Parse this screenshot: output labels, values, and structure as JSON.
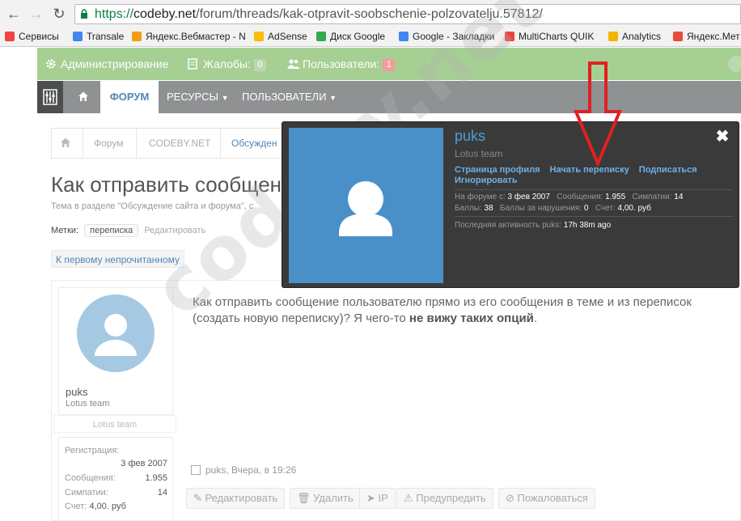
{
  "browser": {
    "url_scheme": "https://",
    "url_host": "codeby.net",
    "url_path": "/forum/threads/kak-otpravit-soobschenie-polzovatelju.57812/",
    "bookmarks": [
      {
        "label": "Сервисы",
        "icon": "apps-grid-icon",
        "color": "#e44"
      },
      {
        "label": "Transale",
        "icon": "google-icon",
        "color": "#4285f4"
      },
      {
        "label": "Яндекс.Вебмастер - N",
        "icon": "yandex-webmaster-icon",
        "color": "#f39c12"
      },
      {
        "label": "AdSense",
        "icon": "adsense-icon",
        "color": "#fbbc05"
      },
      {
        "label": "Диск Google",
        "icon": "google-drive-icon",
        "color": "#34a853"
      },
      {
        "label": "Google - Закладки",
        "icon": "google-icon",
        "color": "#4285f4"
      },
      {
        "label": "MultiCharts QUIK",
        "icon": "chrome-icon",
        "color": "#e8453c"
      },
      {
        "label": "Analytics",
        "icon": "analytics-icon",
        "color": "#f4b400"
      },
      {
        "label": "Яндекс.Мет",
        "icon": "yandex-metrika-icon",
        "color": "#e74c3c"
      }
    ]
  },
  "adminbar": {
    "admin_label": "Администрирование",
    "complaints_label": "Жалобы:",
    "complaints_count": "0",
    "users_label": "Пользователи:",
    "users_count": "1",
    "accent": "#a5cf93"
  },
  "nav": {
    "forum": "ФОРУМ",
    "resources": "РЕСУРСЫ",
    "users": "ПОЛЬЗОВАТЕЛИ"
  },
  "breadcrumb": [
    "Форум",
    "CODEBY.NET",
    "Обсужден"
  ],
  "thread": {
    "title": "Как отправить сообщени",
    "subtitle": "Тема в разделе \"Обсуждение сайта и форума\", с",
    "tags_label": "Метки:",
    "tag": "переписка",
    "tags_edit": "Редактировать",
    "unread_link": "К первому непрочитанному"
  },
  "post": {
    "username": "puks",
    "user_title": "Lotus team",
    "team_banner": "Lotus team",
    "stats": [
      {
        "label": "Регистрация:",
        "value": "3 фев 2007"
      },
      {
        "label": "Сообщения:",
        "value": "1.955"
      },
      {
        "label": "Симпатии:",
        "value": "14"
      },
      {
        "label": "Счет:",
        "value": "4,00. руб"
      }
    ],
    "text_main": "Как отправить сообщение пользователю прямо из его сообщения в теме и из переписок (создать новую переписку)? Я чего-то ",
    "text_bold": "не вижу таких опций",
    "text_end": ".",
    "meta": "puks, Вчера, в 19:26",
    "actions": [
      "Редактировать",
      "Удалить",
      "IP",
      "Предупредить",
      "Пожаловаться"
    ]
  },
  "popup": {
    "name": "puks",
    "title": "Lotus team",
    "links": [
      "Страница профиля",
      "Начать переписку",
      "Подписаться",
      "Игнорировать"
    ],
    "row1": [
      {
        "label": "На форуме с:",
        "value": "3 фев 2007"
      },
      {
        "label": "Сообщения:",
        "value": "1.955"
      },
      {
        "label": "Симпатии:",
        "value": "14"
      }
    ],
    "row2": [
      {
        "label": "Баллы:",
        "value": "38"
      },
      {
        "label": "Баллы за нарушения:",
        "value": "0"
      },
      {
        "label": "Счет:",
        "value": "4,00. руб"
      }
    ],
    "last_activity_label": "Последняя активность puks:",
    "last_activity_value": "17h 38m ago",
    "close": "✖"
  },
  "watermark": "codeby.net"
}
